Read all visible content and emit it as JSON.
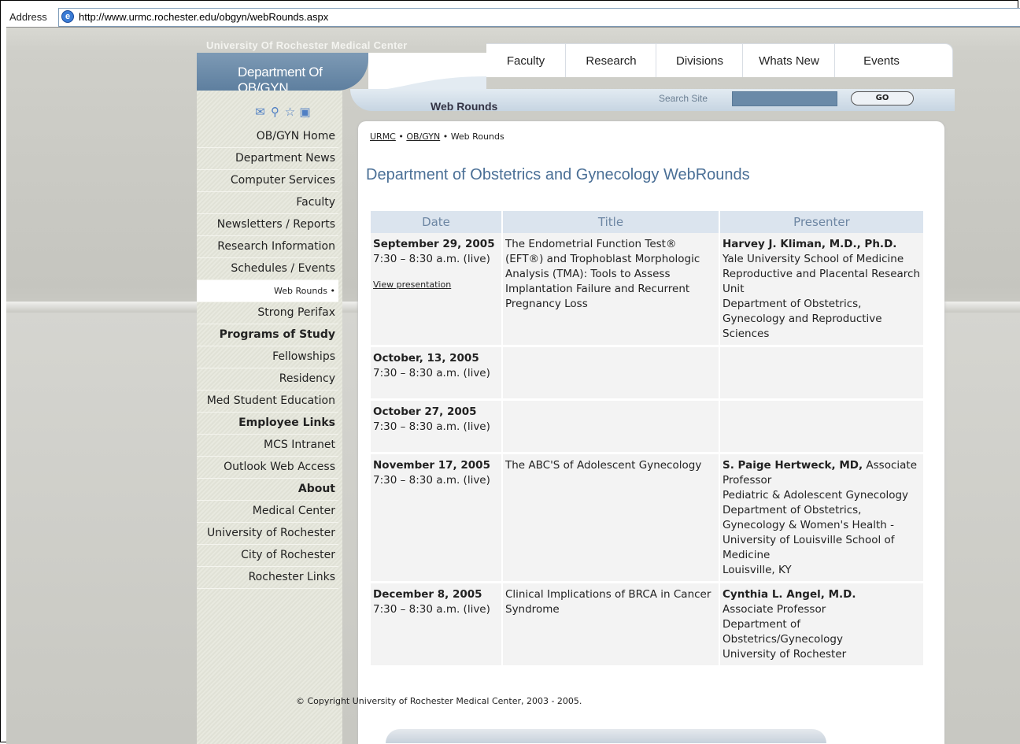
{
  "addressbar": {
    "label": "Address",
    "url": "http://www.urmc.rochester.edu/obgyn/webRounds.aspx"
  },
  "header": {
    "university": "University Of Rochester Medical Center",
    "department": "Department Of OB/GYN",
    "nav": [
      "Faculty",
      "Research",
      "Divisions",
      "Whats New",
      "Events"
    ],
    "search_label": "Search Site",
    "go_label": "GO",
    "section_title": "Web Rounds"
  },
  "sidebar": {
    "icons": [
      "mail-icon",
      "search-icon",
      "star-icon",
      "print-icon"
    ],
    "items": [
      {
        "label": "OB/GYN Home",
        "type": "link"
      },
      {
        "label": "Department News",
        "type": "link"
      },
      {
        "label": "Computer Services",
        "type": "link"
      },
      {
        "label": "Faculty",
        "type": "link"
      },
      {
        "label": "Newsletters / Reports",
        "type": "link"
      },
      {
        "label": "Research Information",
        "type": "link"
      },
      {
        "label": "Schedules / Events",
        "type": "link"
      },
      {
        "label": "Web Rounds •",
        "type": "current"
      },
      {
        "label": "Strong Perifax",
        "type": "link"
      },
      {
        "label": "Programs of Study",
        "type": "heading"
      },
      {
        "label": "Fellowships",
        "type": "link"
      },
      {
        "label": "Residency",
        "type": "link"
      },
      {
        "label": "Med Student Education",
        "type": "link"
      },
      {
        "label": "Employee Links",
        "type": "heading"
      },
      {
        "label": "MCS Intranet",
        "type": "link"
      },
      {
        "label": "Outlook Web Access",
        "type": "link"
      },
      {
        "label": "About",
        "type": "heading"
      },
      {
        "label": "Medical Center",
        "type": "link"
      },
      {
        "label": "University of Rochester",
        "type": "link"
      },
      {
        "label": "City of Rochester",
        "type": "link"
      },
      {
        "label": "Rochester Links",
        "type": "link"
      }
    ]
  },
  "main": {
    "breadcrumb": {
      "urmc": "URMC",
      "sep1": " • ",
      "obgyn": "OB/GYN",
      "sep2": " • ",
      "current": "Web Rounds"
    },
    "title": "Department of Obstetrics and Gynecology WebRounds",
    "table": {
      "headers": [
        "Date",
        "Title",
        "Presenter"
      ],
      "rows": [
        {
          "date": "September 29, 2005",
          "time": "7:30 – 8:30 a.m. (live)",
          "link": "View presentation",
          "title": "The Endometrial Function Test® (EFT®) and Trophoblast Morphologic Analysis (TMA):  Tools to Assess Implantation Failure and Recurrent Pregnancy Loss",
          "presenter_name": "Harvey J. Kliman, M.D., Ph.D.",
          "presenter_suffix": "",
          "presenter_lines": [
            "Yale University School of Medicine",
            "Reproductive and Placental Research Unit",
            "Department of Obstetrics, Gynecology and Reproductive Sciences"
          ]
        },
        {
          "date": "October, 13, 2005",
          "time": "7:30 – 8:30 a.m. (live)",
          "link": "",
          "title": "",
          "presenter_name": "",
          "presenter_suffix": "",
          "presenter_lines": []
        },
        {
          "date": "October 27, 2005",
          "time": "7:30 – 8:30 a.m. (live)",
          "link": "",
          "title": "",
          "presenter_name": "",
          "presenter_suffix": "",
          "presenter_lines": []
        },
        {
          "date": "November 17, 2005",
          "time": "7:30 – 8:30 a.m. (live)",
          "link": "",
          "title": "The ABC'S of Adolescent Gynecology",
          "presenter_name": "S. Paige Hertweck, MD,",
          "presenter_suffix": " Associate Professor",
          "presenter_lines": [
            "Pediatric & Adolescent Gynecology",
            "Department of Obstetrics, Gynecology & Women's Health - University of Louisville School of Medicine",
            "Louisville, KY"
          ]
        },
        {
          "date": "December 8, 2005",
          "time": "7:30 – 8:30 a.m. (live)",
          "link": "",
          "title": "Clinical Implications of BRCA in Cancer Syndrome",
          "presenter_name": "Cynthia L. Angel, M.D.",
          "presenter_suffix": "",
          "presenter_lines": [
            "Associate Professor",
            "Department of Obstetrics/Gynecology",
            "University of Rochester"
          ]
        }
      ]
    },
    "copyright": "© Copyright University of Rochester Medical Center, 2003 - 2005."
  }
}
